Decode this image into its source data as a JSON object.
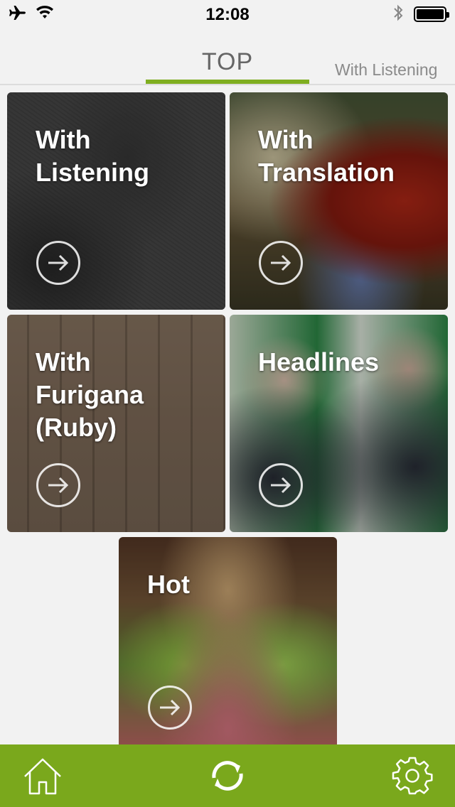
{
  "status_bar": {
    "time": "12:08",
    "icons": [
      "airplane-icon",
      "wifi-icon",
      "bluetooth-icon",
      "battery-icon"
    ]
  },
  "tabs": {
    "active": "TOP",
    "next": "With Listening"
  },
  "cards": {
    "listening": "With\nListening",
    "translation": "With\nTranslation",
    "furigana": "With\nFurigana\n(Ruby)",
    "headlines": "Headlines",
    "hot": "Hot"
  },
  "bottom_bar": {
    "icons": [
      "home-icon",
      "refresh-icon",
      "settings-icon"
    ]
  },
  "colors": {
    "accent": "#7fae20",
    "bottom_bar": "#7aa81c",
    "background": "#f2f2f2"
  }
}
